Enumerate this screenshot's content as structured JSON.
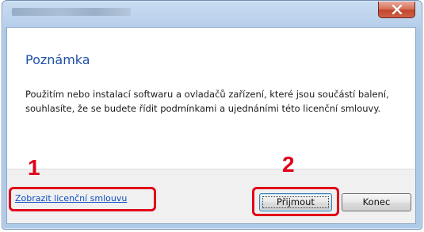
{
  "window": {
    "title": "",
    "close_label": "x"
  },
  "content": {
    "heading": "Poznámka",
    "body": "Použitím nebo instalací softwaru a ovladačů zařízení, které jsou součástí balení, souhlasíte, že se budete řídit podmínkami a ujednáními této licenční smlouvy."
  },
  "footer": {
    "license_link": "Zobrazit licenční smlouvu",
    "accept_button": "Přijmout",
    "end_button": "Konec"
  },
  "annotations": {
    "marker_1": "1",
    "marker_2": "2",
    "highlight_color": "#e0001a"
  },
  "colors": {
    "heading": "#1e4fa6",
    "link": "#0e4fc4",
    "close_button": "#c2462c"
  },
  "icons": {
    "close": "close-icon"
  }
}
